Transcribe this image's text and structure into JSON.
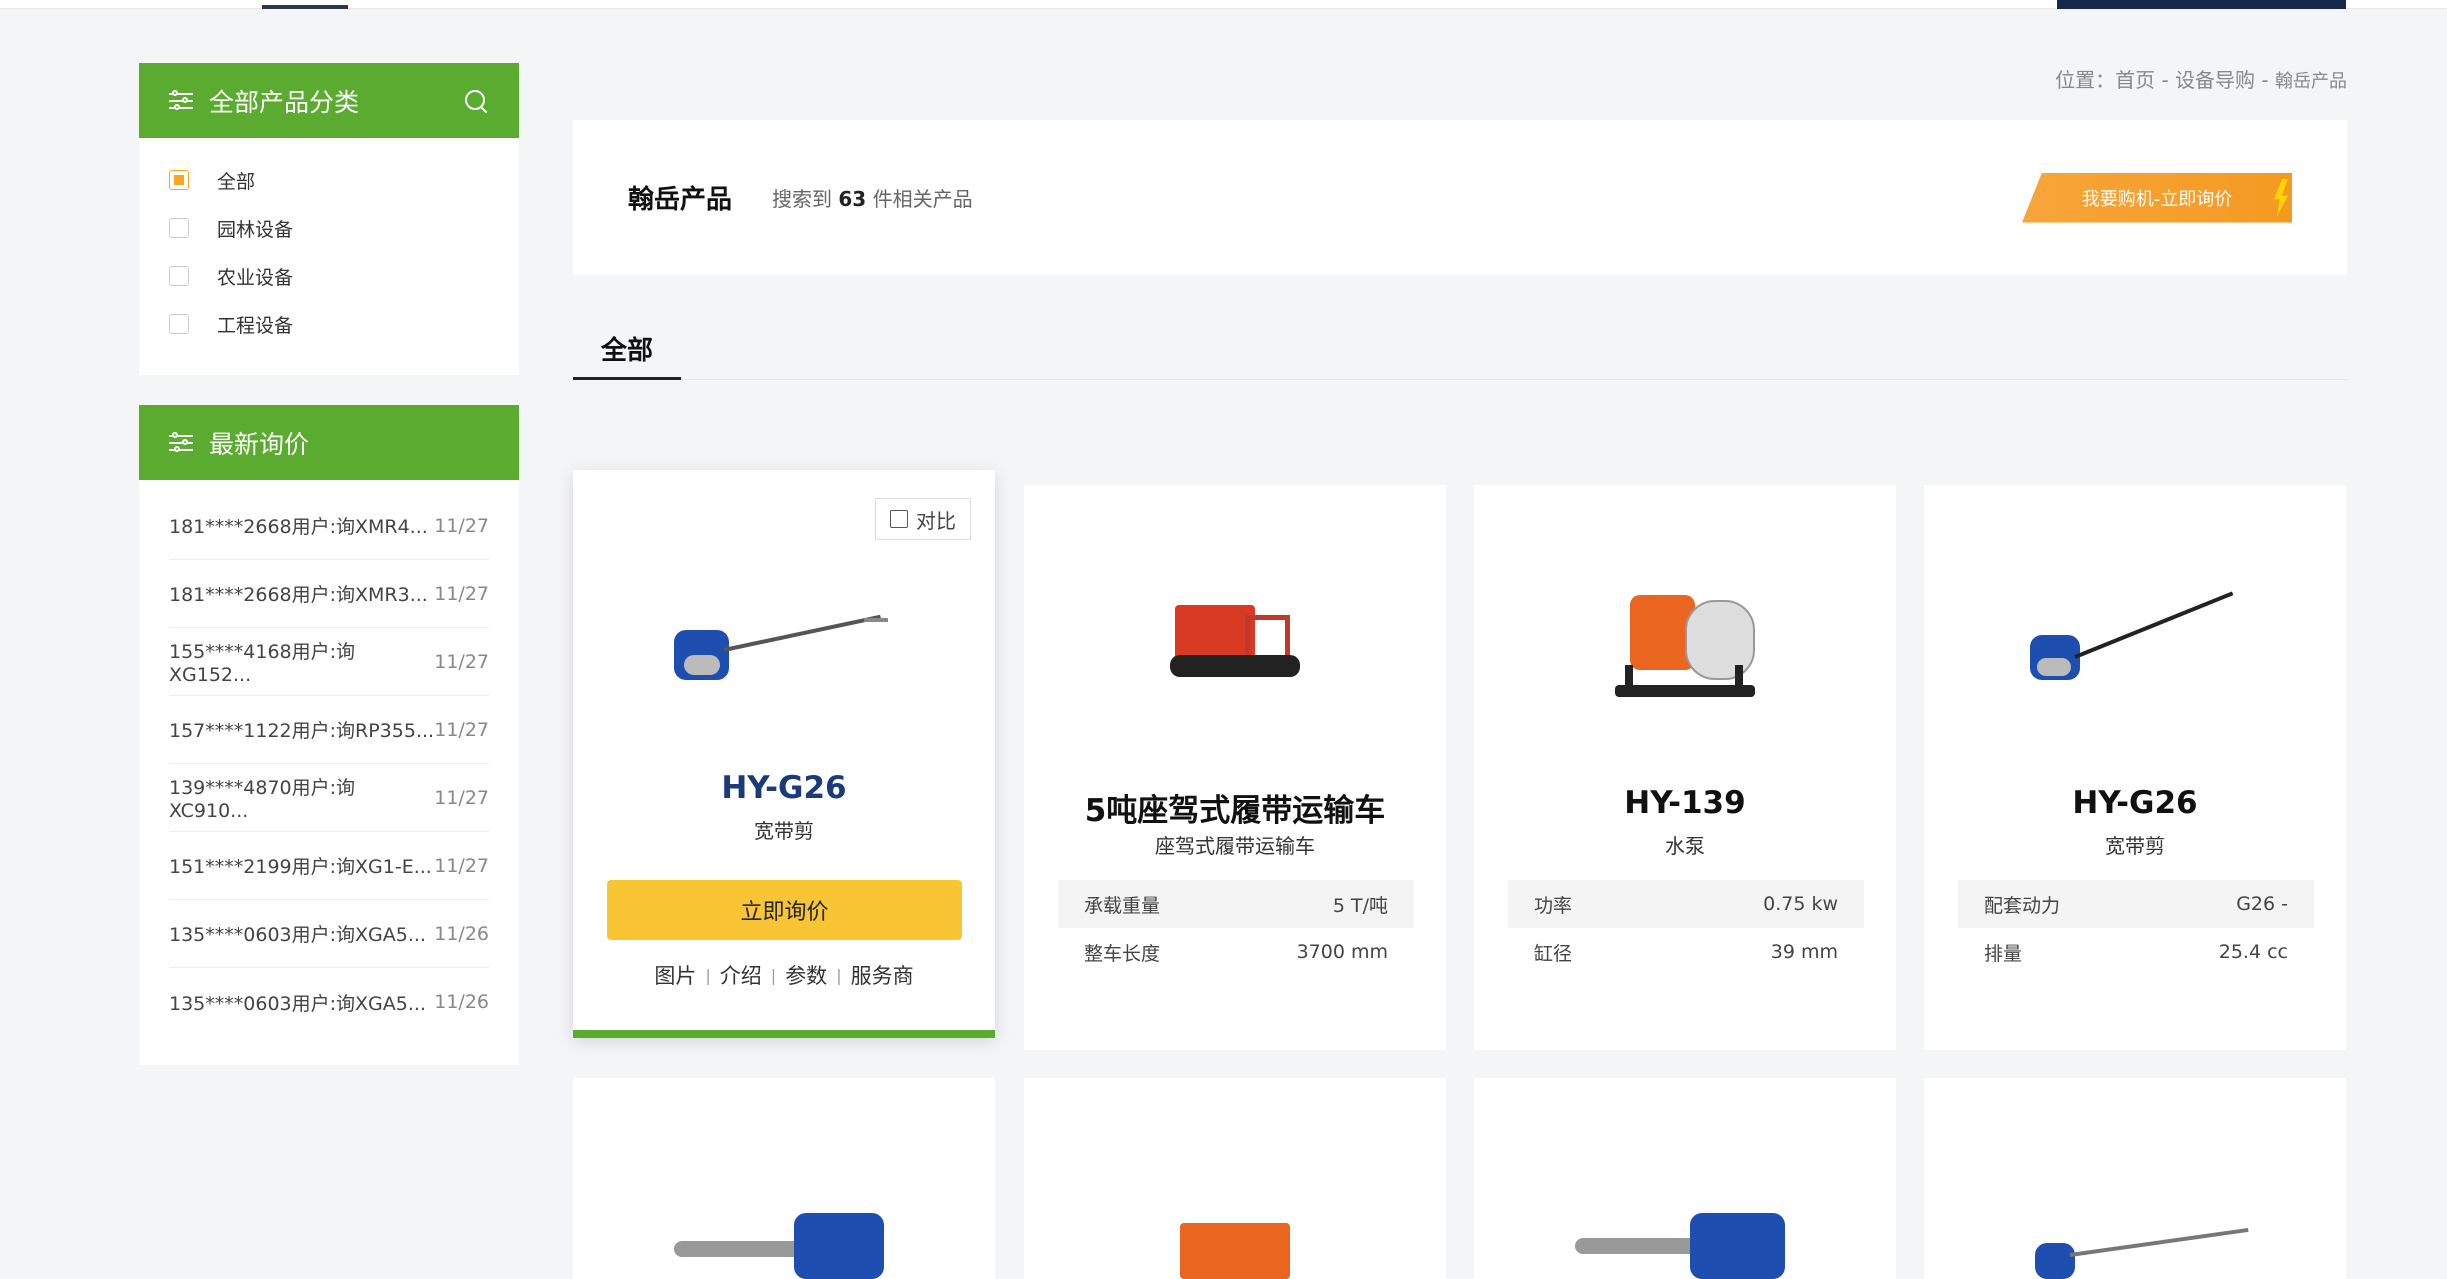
{
  "sidebar": {
    "category_title": "全部产品分类",
    "categories": [
      {
        "label": "全部",
        "checked": true
      },
      {
        "label": "园林设备",
        "checked": false
      },
      {
        "label": "农业设备",
        "checked": false
      },
      {
        "label": "工程设备",
        "checked": false
      }
    ],
    "inquiry_title": "最新询价",
    "inquiries": [
      {
        "text": "181****2668用户:询XMR4...",
        "date": "11/27"
      },
      {
        "text": "181****2668用户:询XMR3...",
        "date": "11/27"
      },
      {
        "text": "155****4168用户:询XG152...",
        "date": "11/27"
      },
      {
        "text": "157****1122用户:询RP355...",
        "date": "11/27"
      },
      {
        "text": "139****4870用户:询XC910...",
        "date": "11/27"
      },
      {
        "text": "151****2199用户:询XG1-E...",
        "date": "11/27"
      },
      {
        "text": "135****0603用户:询XGA5...",
        "date": "11/26"
      },
      {
        "text": "135****0603用户:询XGA5...",
        "date": "11/26"
      }
    ]
  },
  "breadcrumb": {
    "prefix": "位置：",
    "home": "首页",
    "sep": " - ",
    "section": "设备导购",
    "current": "翰岳产品"
  },
  "header": {
    "title": "翰岳产品",
    "count_prefix": "搜索到",
    "count": "63",
    "count_suffix": "件相关产品",
    "cta_label": "我要购机-立即询价"
  },
  "tabs": [
    {
      "label": "全部"
    }
  ],
  "products": [
    {
      "name": "HY-G26",
      "subtitle": "宽带剪",
      "compare_label": "对比",
      "inquire_label": "立即询价",
      "links": [
        "图片",
        "介绍",
        "参数",
        "服务商"
      ],
      "specs": []
    },
    {
      "name": "5吨座驾式履带运输车",
      "subtitle": "座驾式履带运输车",
      "specs": [
        {
          "label": "承载重量",
          "value": "5 T/吨"
        },
        {
          "label": "整车长度",
          "value": "3700 mm"
        }
      ]
    },
    {
      "name": "HY-139",
      "subtitle": "水泵",
      "specs": [
        {
          "label": "功率",
          "value": "0.75 kw"
        },
        {
          "label": "缸径",
          "value": "39 mm"
        }
      ]
    },
    {
      "name": "HY-G26",
      "subtitle": "宽带剪",
      "specs": [
        {
          "label": "配套动力",
          "value": "G26 -"
        },
        {
          "label": "排量",
          "value": "25.4 cc"
        }
      ]
    }
  ],
  "colors": {
    "green": "#5aab2f",
    "orange": "#f39a21",
    "yellow": "#f8c534",
    "navy": "#16284b"
  }
}
